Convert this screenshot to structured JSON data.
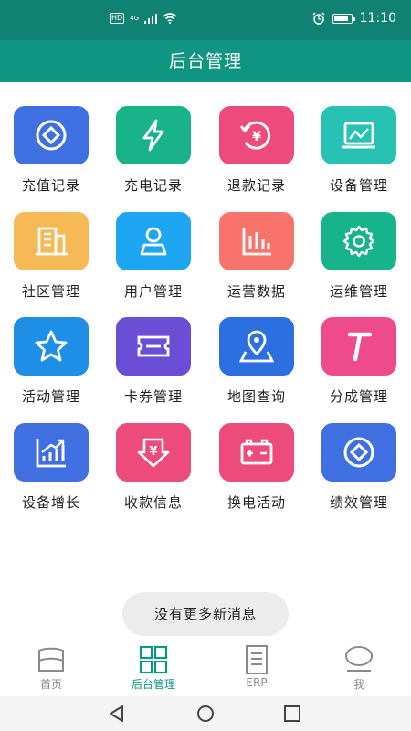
{
  "status": {
    "hd": "HD",
    "network": "4G",
    "time": "11:10"
  },
  "header": {
    "title": "后台管理"
  },
  "grid": [
    {
      "label": "充值记录",
      "icon": "diamond-icon",
      "color": "#3f6fe0"
    },
    {
      "label": "充电记录",
      "icon": "lightning-icon",
      "color": "#19b38a"
    },
    {
      "label": "退款记录",
      "icon": "refund-yen-icon",
      "color": "#ee4b7d"
    },
    {
      "label": "设备管理",
      "icon": "monitor-chart-icon",
      "color": "#28c2b4"
    },
    {
      "label": "社区管理",
      "icon": "building-icon",
      "color": "#f7b955"
    },
    {
      "label": "用户管理",
      "icon": "user-icon",
      "color": "#1fa6f2"
    },
    {
      "label": "运营数据",
      "icon": "bar-chart-icon",
      "color": "#f7736b"
    },
    {
      "label": "运维管理",
      "icon": "gear-icon",
      "color": "#17b38a"
    },
    {
      "label": "活动管理",
      "icon": "star-icon",
      "color": "#1f8ee6"
    },
    {
      "label": "卡券管理",
      "icon": "ticket-icon",
      "color": "#6a4fd6"
    },
    {
      "label": "地图查询",
      "icon": "map-pin-icon",
      "color": "#2c6fe0"
    },
    {
      "label": "分成管理",
      "icon": "letter-t-icon",
      "color": "#ee4b8a"
    },
    {
      "label": "设备增长",
      "icon": "growth-chart-icon",
      "color": "#3f6fe0"
    },
    {
      "label": "收款信息",
      "icon": "receive-yen-icon",
      "color": "#ee4b7d"
    },
    {
      "label": "换电活动",
      "icon": "battery-icon",
      "color": "#ee4b7d"
    },
    {
      "label": "绩效管理",
      "icon": "diamond-icon",
      "color": "#3f6fe0"
    }
  ],
  "toast": "没有更多新消息",
  "tabs": [
    {
      "label": "首页"
    },
    {
      "label": "后台管理"
    },
    {
      "label": "ERP"
    },
    {
      "label": "我"
    }
  ]
}
